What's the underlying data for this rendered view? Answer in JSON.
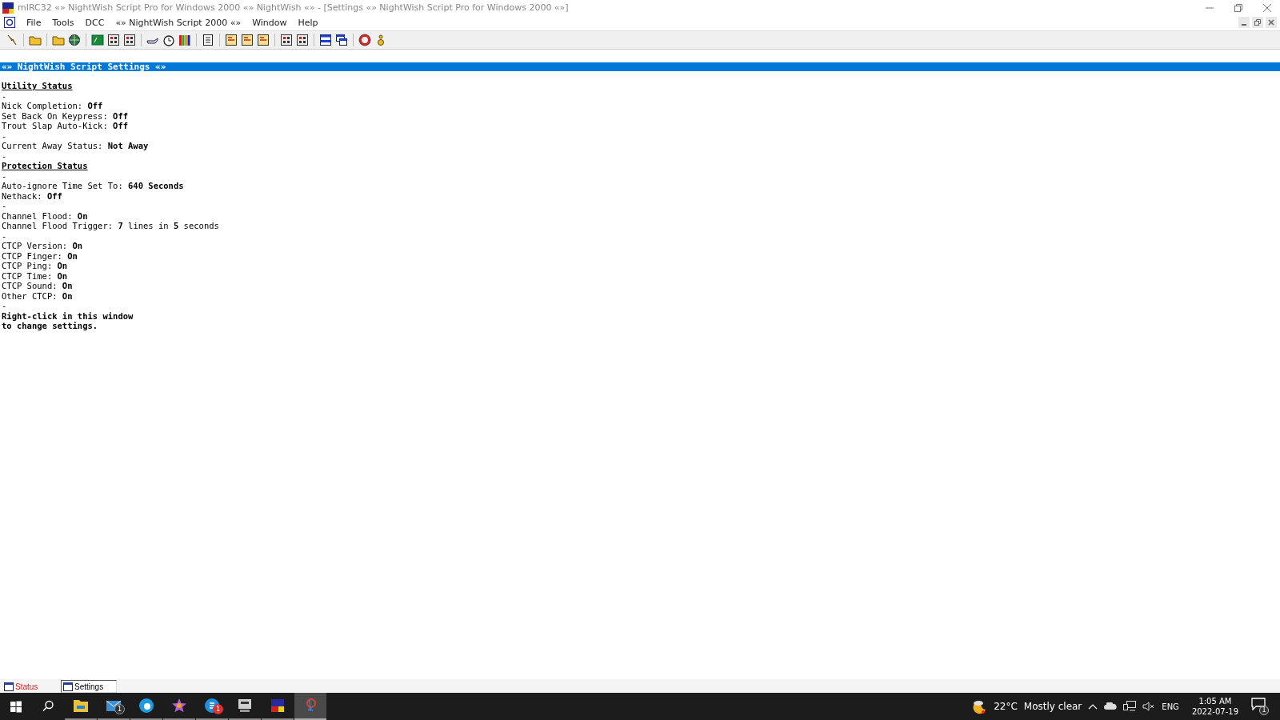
{
  "window": {
    "title": "mIRC32 «» NightWish Script Pro for Windows 2000 «» NightWish «» - [Settings «» NightWish Script Pro for Windows 2000 «»]"
  },
  "menu": [
    "File",
    "Tools",
    "DCC",
    "«» NightWish Script 2000 «»",
    "Window",
    "Help"
  ],
  "document": {
    "title": "«» NightWish Script Settings «»",
    "lines": [
      {
        "kind": "heading",
        "text": "Utility Status"
      },
      {
        "kind": "text",
        "text": "-"
      },
      {
        "kind": "text",
        "text": "Nick Completion: **Off**"
      },
      {
        "kind": "text",
        "text": "Set Back On Keypress: **Off**"
      },
      {
        "kind": "text",
        "text": "Trout Slap Auto-Kick: **Off**"
      },
      {
        "kind": "text",
        "text": "-"
      },
      {
        "kind": "text",
        "text": "Current Away Status: **Not Away**"
      },
      {
        "kind": "text",
        "text": "-"
      },
      {
        "kind": "heading",
        "text": "Protection Status"
      },
      {
        "kind": "text",
        "text": "-"
      },
      {
        "kind": "text",
        "text": "Auto-ignore Time Set To: **640 Seconds**"
      },
      {
        "kind": "text",
        "text": "Nethack: **Off**"
      },
      {
        "kind": "text",
        "text": "-"
      },
      {
        "kind": "text",
        "text": "Channel Flood: **On**"
      },
      {
        "kind": "text",
        "text": "Channel Flood Trigger: **7** lines in **5** seconds"
      },
      {
        "kind": "text",
        "text": "-"
      },
      {
        "kind": "text",
        "text": "CTCP Version: **On**"
      },
      {
        "kind": "text",
        "text": "CTCP Finger: **On**"
      },
      {
        "kind": "text",
        "text": "CTCP Ping: **On**"
      },
      {
        "kind": "text",
        "text": "CTCP Time: **On**"
      },
      {
        "kind": "text",
        "text": "CTCP Sound: **On**"
      },
      {
        "kind": "text",
        "text": "Other CTCP: **On**"
      },
      {
        "kind": "text",
        "text": "-"
      },
      {
        "kind": "note",
        "text": "Right-click in this window"
      },
      {
        "kind": "note",
        "text": "to change settings."
      }
    ]
  },
  "switchbar": [
    {
      "label": "Status",
      "selected": false,
      "alert": true
    },
    {
      "label": "Settings",
      "selected": true,
      "alert": false
    }
  ],
  "taskbar": {
    "apps": [
      {
        "kind": "folder",
        "selected": false
      },
      {
        "kind": "mail",
        "selected": false,
        "badge": "1"
      },
      {
        "kind": "browser",
        "selected": false
      },
      {
        "kind": "star",
        "selected": false
      },
      {
        "kind": "chat",
        "selected": false,
        "badge": "1"
      },
      {
        "kind": "tool",
        "selected": false
      },
      {
        "kind": "irc",
        "selected": false
      },
      {
        "kind": "script",
        "selected": true
      }
    ],
    "weather": "22°C",
    "weather_text": "Mostly clear",
    "language": "ENG",
    "time": "1:05 AM",
    "date": "2022-07-19",
    "notifications": "1"
  }
}
